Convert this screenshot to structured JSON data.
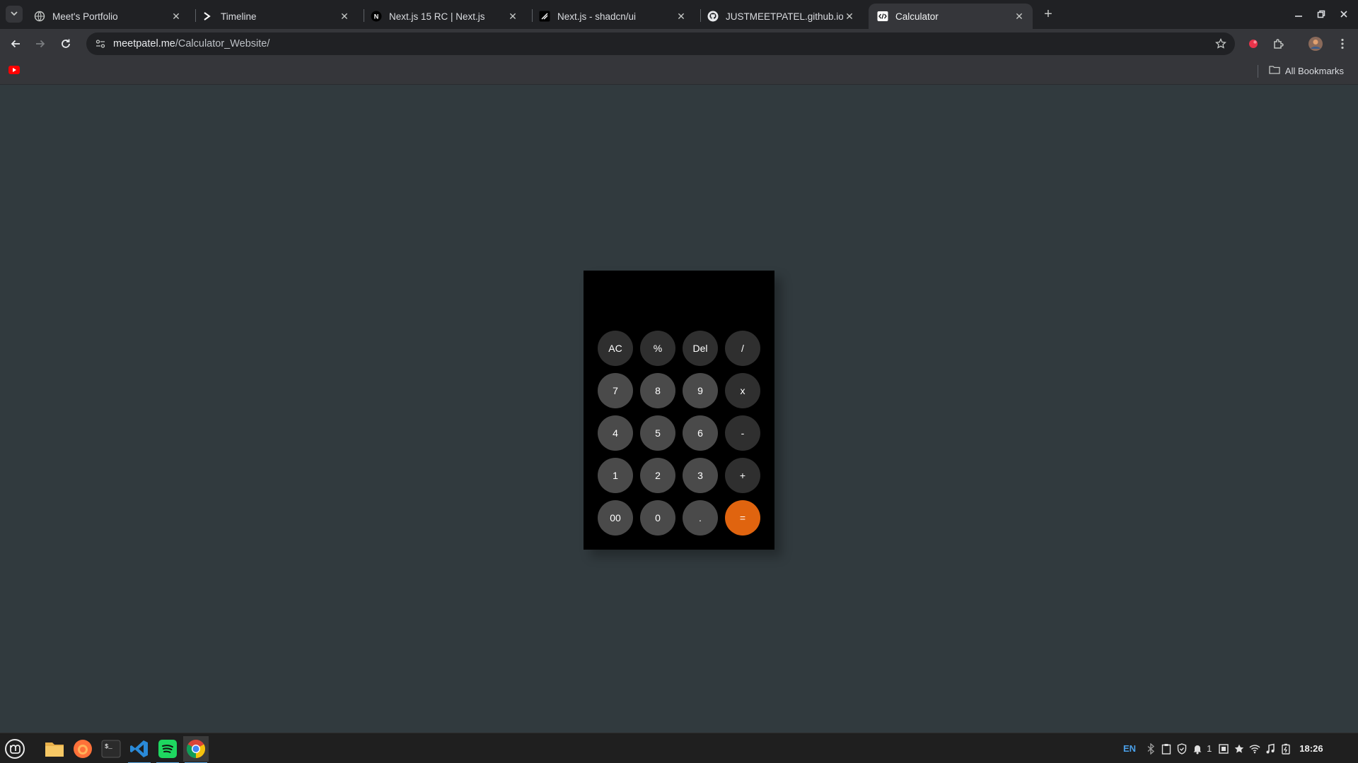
{
  "tabs": [
    {
      "title": "Meet's Portfolio",
      "favicon": "globe-icon",
      "active": false
    },
    {
      "title": "Timeline",
      "favicon": "terminal-prompt-icon",
      "active": false
    },
    {
      "title": "Next.js 15 RC | Next.js",
      "favicon": "nextjs-icon",
      "active": false
    },
    {
      "title": "Next.js - shadcn/ui",
      "favicon": "shadcn-icon",
      "active": false
    },
    {
      "title": "JUSTMEETPATEL.github.io/c",
      "favicon": "github-icon",
      "active": false
    },
    {
      "title": "Calculator",
      "favicon": "code-icon",
      "active": true
    }
  ],
  "toolbar": {
    "url_host": "meetpatel.me",
    "url_path": "/Calculator_Website/"
  },
  "bookmarks": {
    "all_bookmarks_label": "All Bookmarks"
  },
  "calculator": {
    "display": "",
    "keys": [
      [
        "AC",
        "%",
        "Del",
        "/"
      ],
      [
        "7",
        "8",
        "9",
        "x"
      ],
      [
        "4",
        "5",
        "6",
        "-"
      ],
      [
        "1",
        "2",
        "3",
        "+"
      ],
      [
        "00",
        "0",
        ".",
        "="
      ]
    ],
    "colors": {
      "number_key": "#4a4a4a",
      "operator_key": "#2f2f2f",
      "equals_key": "#e0640f",
      "body": "#000000",
      "page_bg": "#313a3e"
    }
  },
  "taskbar": {
    "apps": [
      "linux-mint-menu-icon",
      "files-icon",
      "firefox-icon",
      "terminal-icon",
      "vscode-icon",
      "spotify-icon",
      "chrome-icon"
    ],
    "keyboard_layout": "EN",
    "notification_count": "1",
    "clock": "18:26"
  }
}
